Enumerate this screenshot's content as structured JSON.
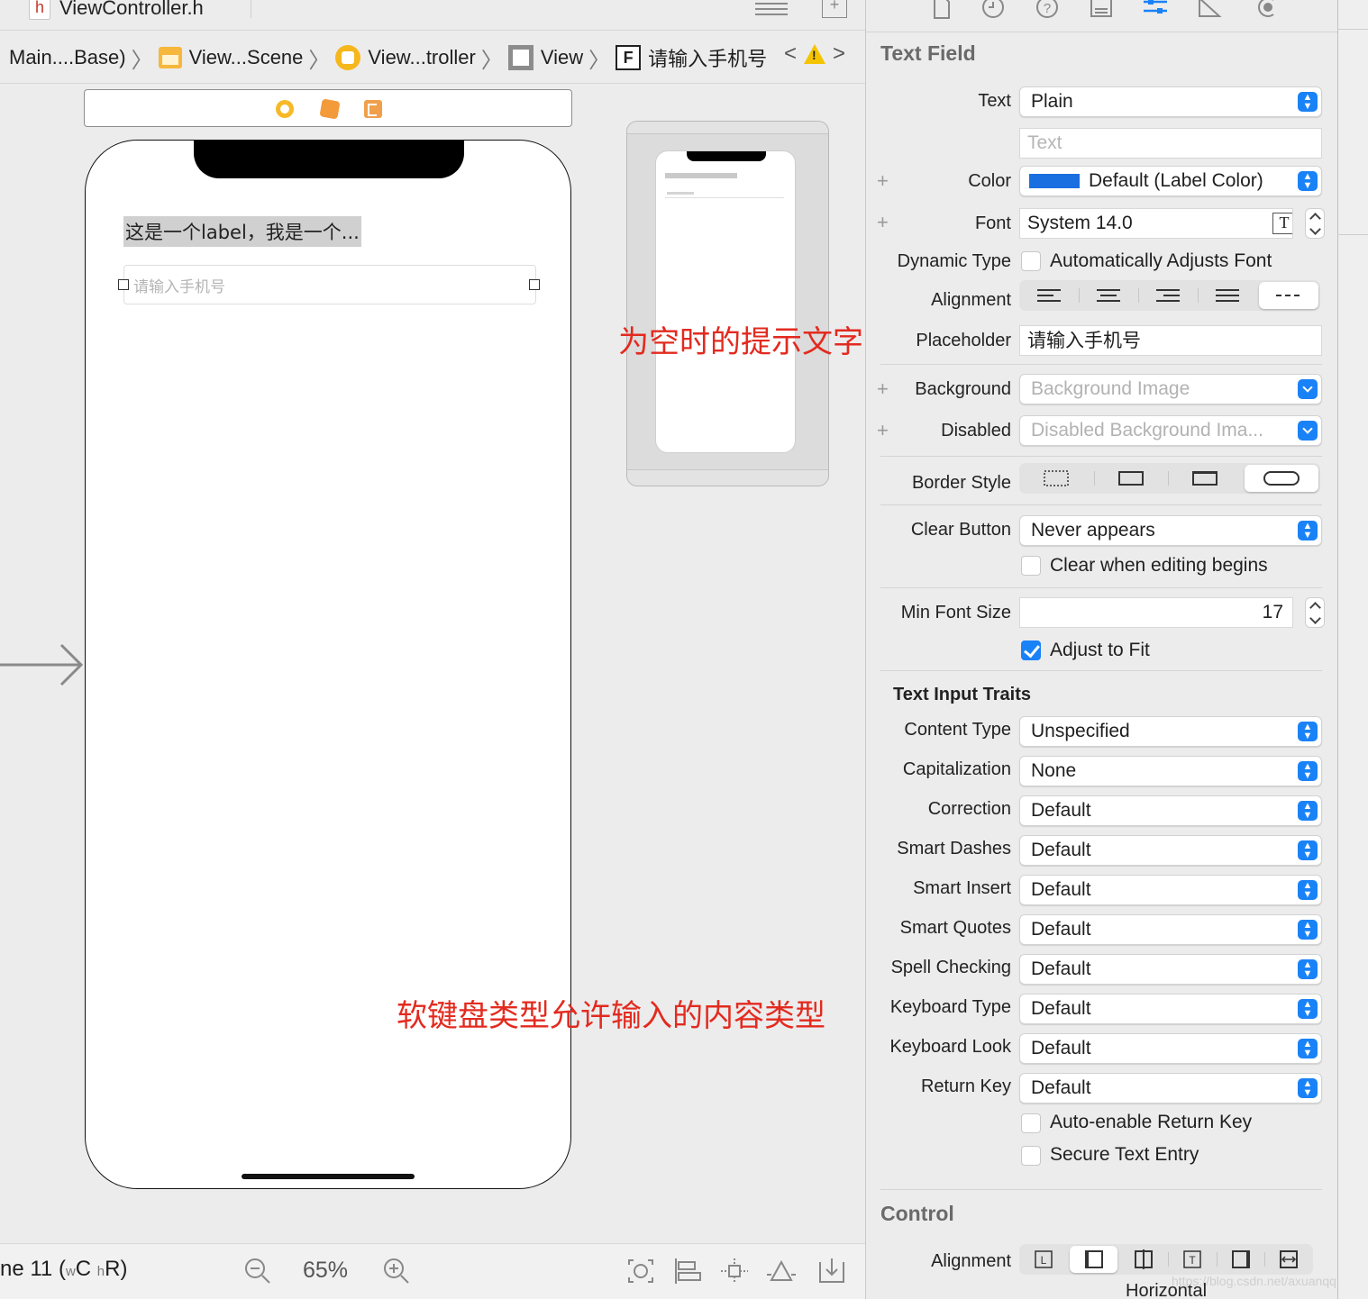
{
  "file_tab": {
    "icon_letter": "h",
    "file_name": "ViewController.h"
  },
  "breadcrumb": {
    "items": [
      {
        "label": "Main....Base)",
        "icon": "storyboard-icon"
      },
      {
        "label": "View...Scene",
        "icon": "scene-icon"
      },
      {
        "label": "View...troller",
        "icon": "view-controller-icon"
      },
      {
        "label": "View",
        "icon": "view-icon"
      },
      {
        "label": "请输入手机号",
        "icon": "text-field-icon",
        "icon_letter": "F"
      }
    ],
    "warning_mark": "!"
  },
  "canvas": {
    "label_text": "这是一个label，我是一个...",
    "field_placeholder": "请输入手机号"
  },
  "annotations": {
    "placeholder_note": "为空时的提示文字",
    "keyboard_note": "软键盘类型允许输入的内容类型",
    "color": "#e32a1f"
  },
  "bottom_bar": {
    "device_prefix": "ne 11 (",
    "w": "w",
    "c": "C",
    "h": "h",
    "r": "R)",
    "zoom": "65%"
  },
  "inspector": {
    "section_title": "Text Field",
    "text": {
      "label": "Text",
      "value": "Plain",
      "placeholder": "Text"
    },
    "color": {
      "label": "Color",
      "value": "Default (Label Color)",
      "swatch": "#1a6fe0"
    },
    "font": {
      "label": "Font",
      "value": "System 14.0",
      "font_button": "T"
    },
    "dynamic_type": {
      "label": "Dynamic Type",
      "checkbox": "Automatically Adjusts Font",
      "checked": false
    },
    "alignment": {
      "label": "Alignment",
      "options": [
        "left",
        "center",
        "right",
        "justified",
        "natural"
      ],
      "selected": "natural"
    },
    "placeholder": {
      "label": "Placeholder",
      "value": "请输入手机号"
    },
    "background": {
      "label": "Background",
      "value": "Background Image"
    },
    "disabled": {
      "label": "Disabled",
      "value": "Disabled Background Ima..."
    },
    "border_style": {
      "label": "Border Style",
      "options": [
        "none",
        "line",
        "bezel",
        "rounded-rect"
      ],
      "selected": "rounded-rect"
    },
    "clear_button": {
      "label": "Clear Button",
      "value": "Never appears",
      "checkbox": "Clear when editing begins",
      "checked": false
    },
    "min_font_size": {
      "label": "Min Font Size",
      "value": "17",
      "checkbox": "Adjust to Fit",
      "checked": true
    },
    "traits_title": "Text Input Traits",
    "traits": [
      {
        "label": "Content Type",
        "value": "Unspecified"
      },
      {
        "label": "Capitalization",
        "value": "None"
      },
      {
        "label": "Correction",
        "value": "Default"
      },
      {
        "label": "Smart Dashes",
        "value": "Default"
      },
      {
        "label": "Smart Insert",
        "value": "Default"
      },
      {
        "label": "Smart Quotes",
        "value": "Default"
      },
      {
        "label": "Spell Checking",
        "value": "Default"
      },
      {
        "label": "Keyboard Type",
        "value": "Default"
      },
      {
        "label": "Keyboard Look",
        "value": "Default"
      },
      {
        "label": "Return Key",
        "value": "Default"
      }
    ],
    "auto_enable_return": {
      "label": "Auto-enable Return Key",
      "checked": false
    },
    "secure_entry": {
      "label": "Secure Text Entry",
      "checked": false
    },
    "control_title": "Control",
    "control_alignment": {
      "label": "Alignment",
      "sub_label": "Horizontal",
      "options": [
        "leading",
        "left",
        "center",
        "right",
        "trailing",
        "fill"
      ],
      "selected": "left"
    }
  },
  "watermark": "https://blog.csdn.net/axuanqq",
  "accent_color": "#1a82f7"
}
